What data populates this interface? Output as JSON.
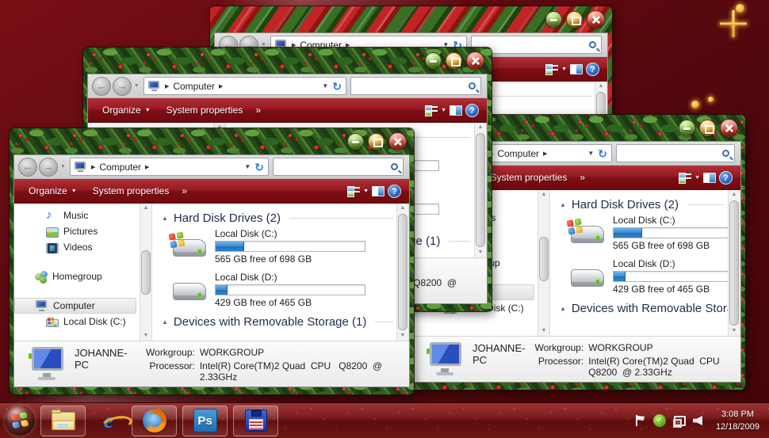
{
  "explorer": {
    "breadcrumb_root": "Computer",
    "search_value": "",
    "toolbar": {
      "organize": "Organize",
      "system_properties": "System properties",
      "more": "»"
    },
    "sidebar": [
      {
        "label": "Music"
      },
      {
        "label": "Pictures"
      },
      {
        "label": "Videos"
      },
      {
        "label": "Homegroup"
      },
      {
        "label": "Computer"
      },
      {
        "label": "Local Disk (C:)"
      }
    ],
    "groups": {
      "hard_disks": "Hard Disk Drives (2)",
      "removable": "Devices with Removable Storage (1)"
    },
    "drives": [
      {
        "name": "Local Disk (C:)",
        "caption": "565 GB free of 698 GB",
        "used_pct": 19
      },
      {
        "name": "Local Disk (D:)",
        "caption": "429 GB free of 465 GB",
        "used_pct": 8
      }
    ],
    "details": {
      "computer_name": "JOHANNE-PC",
      "workgroup_label": "Workgroup:",
      "workgroup": "WORKGROUP",
      "processor_label": "Processor:",
      "processor": "Intel(R) Core(TM)2 Quad  CPU   Q8200  @ 2.33GHz"
    }
  },
  "icons": {
    "back_arrow": "←",
    "forward_arrow": "→",
    "nav_drop": "▼",
    "crumb_sep": "▶",
    "crumb_drop": "▼",
    "refresh": "↻",
    "organize_drop": "▼",
    "views_drop": "▼",
    "help": "?",
    "group_collapse": "▲",
    "scroll_up": "▲",
    "scroll_down": "▼",
    "check": "✓"
  },
  "taskbar": {
    "clock_time": "3:08 PM",
    "clock_date": "12/18/2009"
  }
}
